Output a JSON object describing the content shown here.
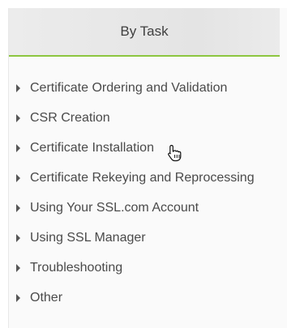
{
  "header": {
    "title": "By Task"
  },
  "colors": {
    "accent": "#8cc63f",
    "text": "#4a4a4a"
  },
  "items": [
    {
      "label": "Certificate Ordering and Validation"
    },
    {
      "label": "CSR Creation"
    },
    {
      "label": "Certificate Installation"
    },
    {
      "label": "Certificate Rekeying and Reprocessing"
    },
    {
      "label": "Using Your SSL.com Account"
    },
    {
      "label": "Using SSL Manager"
    },
    {
      "label": "Troubleshooting"
    },
    {
      "label": "Other"
    }
  ]
}
